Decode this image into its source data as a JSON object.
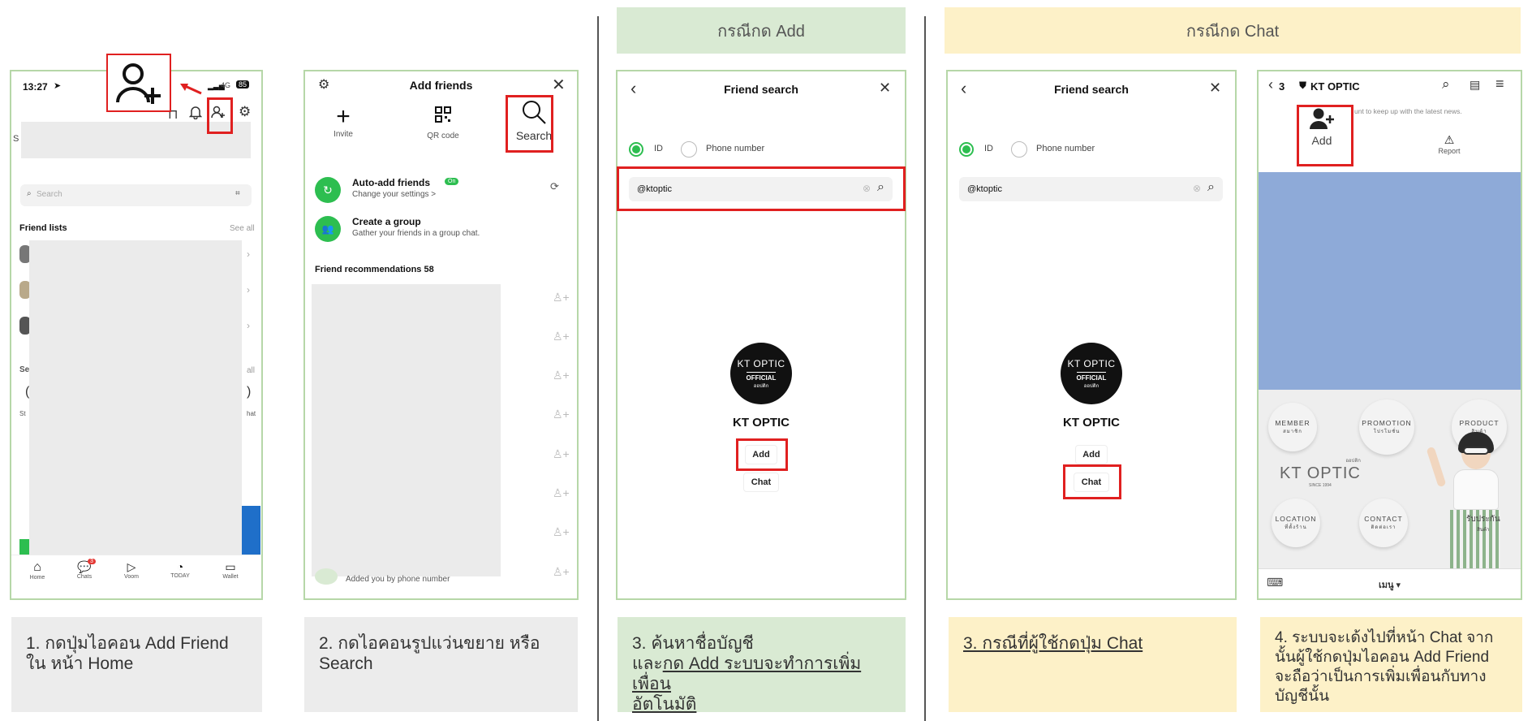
{
  "sections": {
    "add_header": "กรณีกด Add",
    "chat_header": "กรณีกด Chat"
  },
  "colors": {
    "phone_border": "#b6d7a8",
    "highlight_red": "#e02020",
    "line_green": "#2dbe50",
    "section_green": "#d9ead3",
    "section_yellow": "#fdf1c8",
    "caption_gray": "#ececec",
    "profile_blue": "#8eaad8"
  },
  "screen1": {
    "time": "13:27",
    "network": "4G",
    "battery": "85",
    "search_placeholder": "Search",
    "friend_lists_label": "Friend lists",
    "see_all": "See all",
    "partial_letters": {
      "s1": "S",
      "se": "Se",
      "all": "all",
      "st": "St",
      "hat": "hat"
    },
    "tabbar": [
      {
        "label": "Home",
        "icon": "home-icon"
      },
      {
        "label": "Chats",
        "icon": "chat-bubble-icon",
        "badge": "3"
      },
      {
        "label": "Voom",
        "icon": "play-icon"
      },
      {
        "label": "TODAY",
        "icon": "news-icon"
      },
      {
        "label": "Wallet",
        "icon": "wallet-icon"
      }
    ],
    "caption": "1. กดปุ่มไอคอน Add Friend ใน หน้า Home"
  },
  "screen2": {
    "title": "Add friends",
    "actions": [
      {
        "label": "Invite",
        "icon": "plus-icon"
      },
      {
        "label": "QR code",
        "icon": "qr-code-icon"
      },
      {
        "label": "Search",
        "icon": "search-icon"
      }
    ],
    "auto_add_title": "Auto-add friends",
    "auto_add_badge": "On",
    "auto_add_sub": "Change your settings >",
    "create_group_title": "Create a group",
    "create_group_sub": "Gather your friends in a group chat.",
    "recommendations_label": "Friend recommendations 58",
    "added_by_phone": "Added you by phone number",
    "caption": "2. กดไอคอนรูปแว่นขยาย หรือ Search"
  },
  "screen3": {
    "title": "Friend search",
    "radio_id": "ID",
    "radio_phone": "Phone number",
    "search_value": "@ktoptic",
    "logo_main": "KT OPTIC",
    "logo_sub": "OFFICIAL",
    "logo_tiny": "ออปติก",
    "account_name": "KT OPTIC",
    "add_button": "Add",
    "chat_button": "Chat",
    "caption_line1": "3. ค้นหาชื่อบัญชี",
    "caption_line2_prefix": "และ",
    "caption_line2_underlined": "กด Add ระบบจะทำการเพิ่มเพื่อน",
    "caption_line3": "อัตโนมัติ"
  },
  "screen4": {
    "title": "Friend search",
    "radio_id": "ID",
    "radio_phone": "Phone number",
    "search_value": "@ktoptic",
    "logo_main": "KT OPTIC",
    "logo_sub": "OFFICIAL",
    "logo_tiny": "ออปติก",
    "account_name": "KT OPTIC",
    "add_button": "Add",
    "chat_button": "Chat",
    "caption": "3. กรณีที่ผู้ใช้กดปุ่ม Chat"
  },
  "screen5": {
    "back_count": "3",
    "account_name": "KT OPTIC",
    "notice": "unt to keep up with the latest news.",
    "add_label": "Add",
    "report_label": "Report",
    "menu_items": [
      {
        "title": "MEMBER",
        "sub": "สมาชิก"
      },
      {
        "title": "PROMOTION",
        "sub": "โปรโมชั่น"
      },
      {
        "title": "PRODUCT",
        "sub": "สินค้า"
      },
      {
        "title": "LOCATION",
        "sub": "ที่ตั้งร้าน"
      },
      {
        "title": "CONTACT",
        "sub": "ติดต่อเรา"
      },
      {
        "title": "รับประกัน",
        "sub": "สินค้า"
      }
    ],
    "brand": "KT OPTIC",
    "brand_top": "ออปติก",
    "brand_since": "SINCE 1994",
    "bottom_menu": "เมนู ▾",
    "caption": "4. ระบบจะเด้งไปที่หน้า Chat จาก นั้นผู้ใช้กดปุ่มไอคอน Add Friend จะถือว่าเป็นการเพิ่มเพื่อนกับทาง บัญชีนั้น"
  }
}
